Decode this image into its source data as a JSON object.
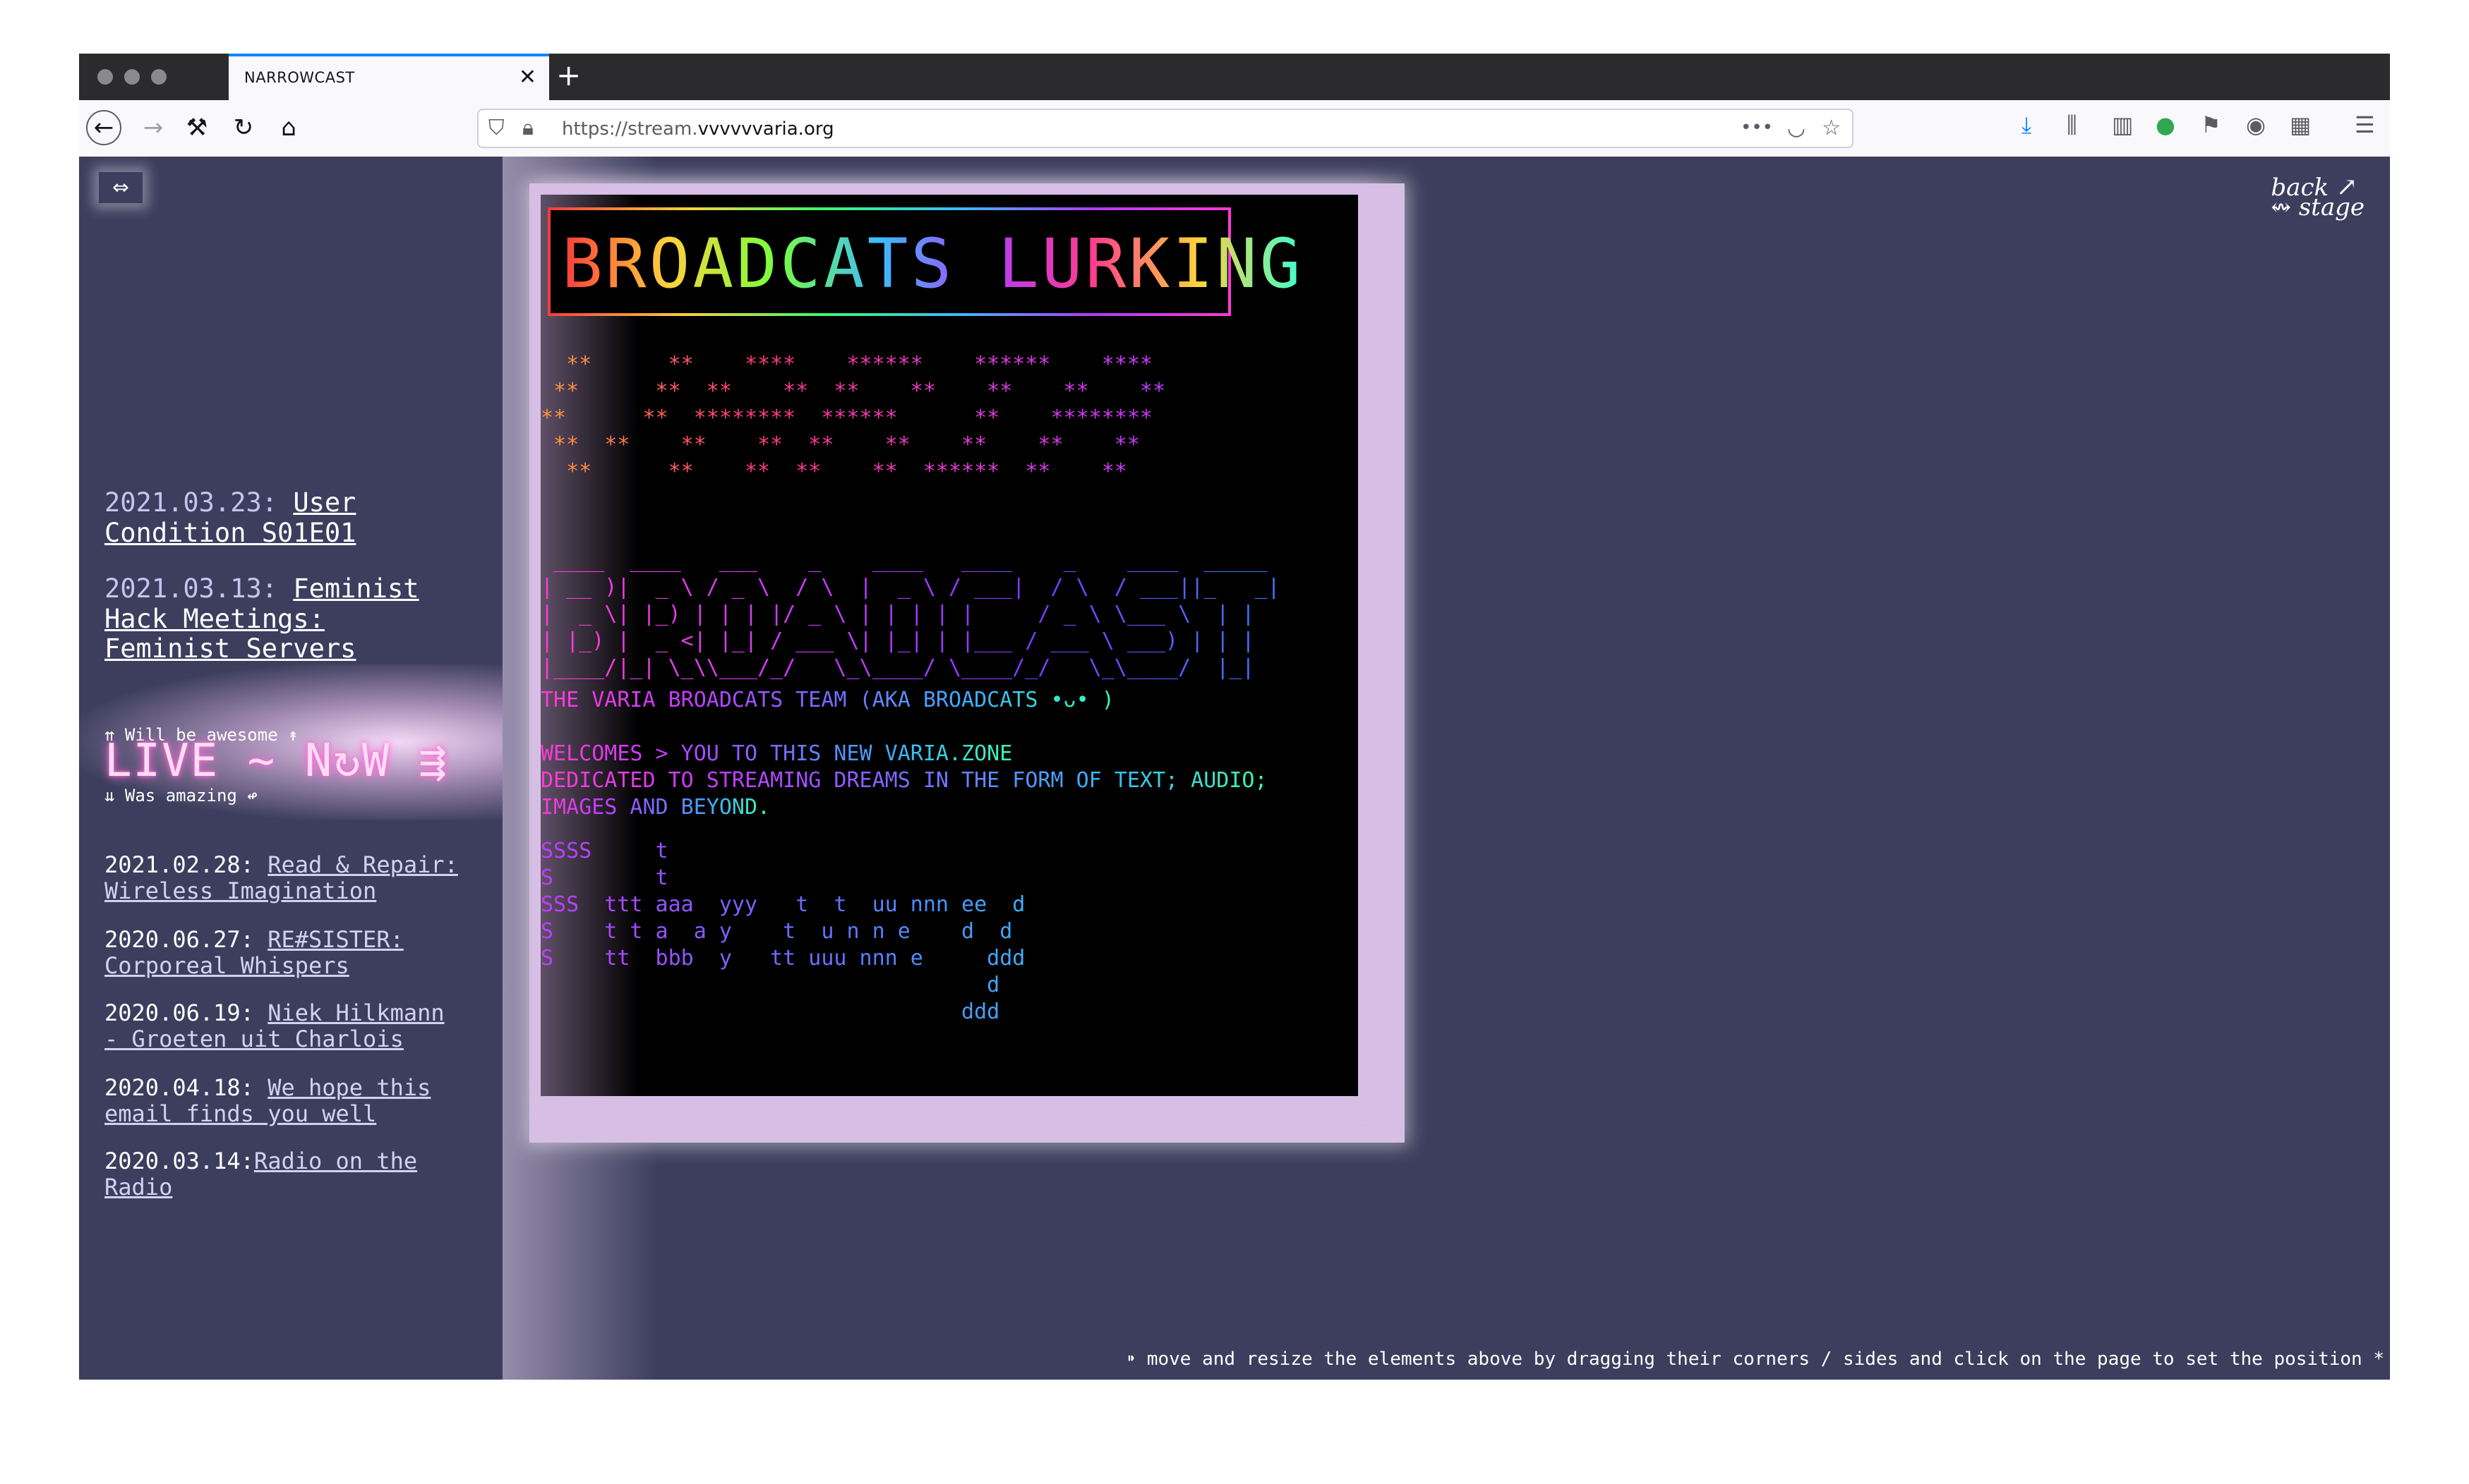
{
  "browser": {
    "tab_title": "NARROWCAST",
    "tab_close": "✕",
    "new_tab": "+",
    "url_prefix": "https://stream.",
    "url_domain": "vvvvvvaria.org",
    "url_menu": "•••"
  },
  "sidebar": {
    "toggle_label": "⇔",
    "upcoming": [
      {
        "date": "2021.03.23: ",
        "title": "User Condition S01E01"
      },
      {
        "date": "2021.03.13: ",
        "title": "Feminist Hack Meetings: Feminist Servers"
      }
    ],
    "live": {
      "top_hint": "⇈ Will be awesome ↟",
      "label": "LIVE ~ N↻W ⇶",
      "bottom_hint": "⇊ Was amazing ↫"
    },
    "past": [
      {
        "date": "2021.02.28: ",
        "title": "Read & Repair: Wireless Imagination"
      },
      {
        "date": "2020.06.27: ",
        "title": "RE#SISTER: Corporeal Whispers"
      },
      {
        "date": "2020.06.19: ",
        "title": "Niek Hilkmann - Groeten uit Charlois"
      },
      {
        "date": "2020.04.18: ",
        "title": "We hope this email finds you well"
      },
      {
        "date": "2020.03.14:",
        "title": "Radio on the Radio"
      }
    ]
  },
  "stream": {
    "title": "BROADCATS LURKING",
    "stars_art": "  **      **    ****    ******    ******    ****\n **      **  **    **  **    **    **    **    **\n**      **  ********  ******      **    ********\n **  **    **    **  **    **    **    **    **\n  **      **    **  **    **  ******  **    **",
    "broadcast_art": " ____  ____   ___    _    ____   ____    _    ____  _____\n| __ )|  _ \\ / _ \\  / \\  |  _ \\ / ___|  / \\  / ___||_   _|\n|  _ \\| |_) | | | |/ _ \\ | | | | |     / _ \\ \\___ \\  | |\n| |_) |  _ <| |_| / ___ \\| |_| | |___ / ___ \\ ___) | | |\n|____/|_| \\_\\\\___/_/   \\_\\____/ \\____/_/   \\_\\____/  |_|",
    "line1": "THE VARIA BROADCATS TEAM (AKA BROADCATS •ᴗ• )",
    "line2": "WELCOMES > YOU TO THIS NEW VARIA.ZONE",
    "line3": "DEDICATED TO STREAMING DREAMS IN THE FORM OF TEXT; AUDIO;",
    "line4": "IMAGES AND BEYOND.",
    "stay_art": "SSSS     t\nS        t\nSSS  ttt aaa  yyy   t  t  uu nnn ee  d\nS    t t a  a y    t  u n n e    d  d\nS    tt  bbb  y   tt uuu nnn e     ddd\n                                   d\n                                 ddd"
  },
  "backstage": {
    "line1": "back",
    "arrow": "↗",
    "line2": "↭ stage"
  },
  "footer": {
    "note": "⁍ move and resize the elements above by dragging their corners / sides and click on the page to set the position *"
  }
}
